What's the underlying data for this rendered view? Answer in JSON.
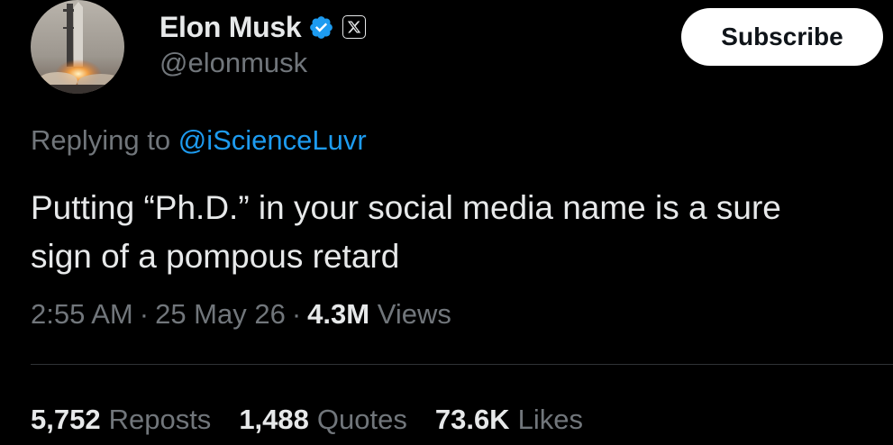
{
  "author": {
    "display_name": "Elon Musk",
    "handle": "@elonmusk",
    "verified_icon": "verified-check-icon",
    "affiliate_icon": "x-logo-icon",
    "verified_color": "#1d9bf0"
  },
  "actions": {
    "subscribe_label": "Subscribe"
  },
  "reply": {
    "prefix": "Replying to",
    "mention": "@iScienceLuvr"
  },
  "tweet": {
    "lines": [
      "Putting “Ph.D.” in your social media name is a sure",
      "sign of a pompous retard"
    ]
  },
  "meta": {
    "time": "2:55 AM",
    "separator": "·",
    "date": "25 May 26",
    "views_count": "4.3M",
    "views_label": "Views"
  },
  "stats": [
    {
      "count": "5,752",
      "label": "Reposts"
    },
    {
      "count": "1,488",
      "label": "Quotes"
    },
    {
      "count": "73.6K",
      "label": "Likes"
    }
  ],
  "colors": {
    "background": "#000000",
    "text": "#e7e9ea",
    "muted": "#71767b",
    "link": "#1d9bf0",
    "divider": "#2f3336"
  }
}
